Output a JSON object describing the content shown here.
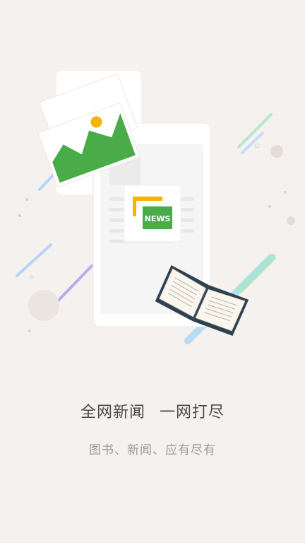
{
  "onboarding": {
    "headline_left": "全网新闻",
    "headline_right": "一网打尽",
    "subtitle": "图书、新闻、应有尽有"
  },
  "illustration": {
    "news_badge_text": "NEWS",
    "colors": {
      "background": "#f5f1ee",
      "phone": "#ffffff",
      "green": "#4aab49",
      "yellow": "#f4b400",
      "book_cover": "#2f4051"
    }
  }
}
